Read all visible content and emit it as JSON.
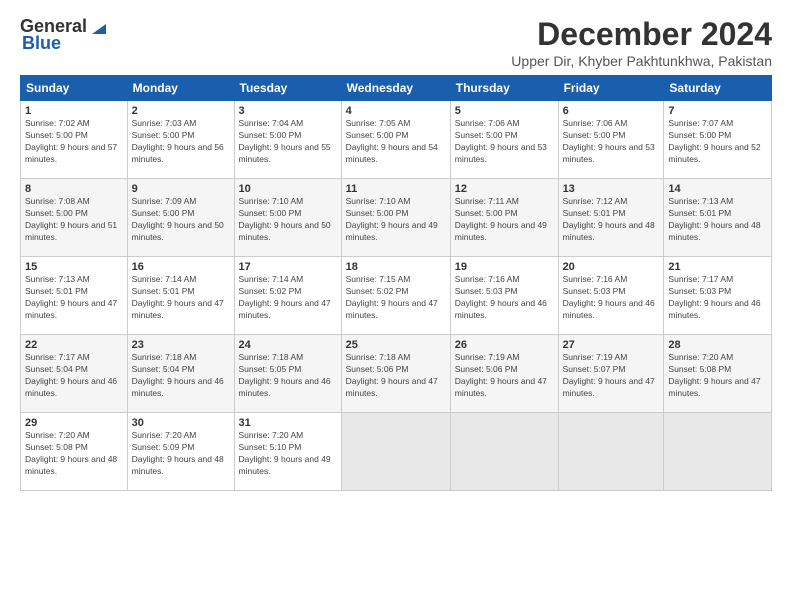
{
  "logo": {
    "general": "General",
    "blue": "Blue"
  },
  "title": "December 2024",
  "location": "Upper Dir, Khyber Pakhtunkhwa, Pakistan",
  "days_of_week": [
    "Sunday",
    "Monday",
    "Tuesday",
    "Wednesday",
    "Thursday",
    "Friday",
    "Saturday"
  ],
  "weeks": [
    [
      {
        "day": "1",
        "sunrise": "7:02 AM",
        "sunset": "5:00 PM",
        "daylight": "9 hours and 57 minutes."
      },
      {
        "day": "2",
        "sunrise": "7:03 AM",
        "sunset": "5:00 PM",
        "daylight": "9 hours and 56 minutes."
      },
      {
        "day": "3",
        "sunrise": "7:04 AM",
        "sunset": "5:00 PM",
        "daylight": "9 hours and 55 minutes."
      },
      {
        "day": "4",
        "sunrise": "7:05 AM",
        "sunset": "5:00 PM",
        "daylight": "9 hours and 54 minutes."
      },
      {
        "day": "5",
        "sunrise": "7:06 AM",
        "sunset": "5:00 PM",
        "daylight": "9 hours and 53 minutes."
      },
      {
        "day": "6",
        "sunrise": "7:06 AM",
        "sunset": "5:00 PM",
        "daylight": "9 hours and 53 minutes."
      },
      {
        "day": "7",
        "sunrise": "7:07 AM",
        "sunset": "5:00 PM",
        "daylight": "9 hours and 52 minutes."
      }
    ],
    [
      {
        "day": "8",
        "sunrise": "7:08 AM",
        "sunset": "5:00 PM",
        "daylight": "9 hours and 51 minutes."
      },
      {
        "day": "9",
        "sunrise": "7:09 AM",
        "sunset": "5:00 PM",
        "daylight": "9 hours and 50 minutes."
      },
      {
        "day": "10",
        "sunrise": "7:10 AM",
        "sunset": "5:00 PM",
        "daylight": "9 hours and 50 minutes."
      },
      {
        "day": "11",
        "sunrise": "7:10 AM",
        "sunset": "5:00 PM",
        "daylight": "9 hours and 49 minutes."
      },
      {
        "day": "12",
        "sunrise": "7:11 AM",
        "sunset": "5:00 PM",
        "daylight": "9 hours and 49 minutes."
      },
      {
        "day": "13",
        "sunrise": "7:12 AM",
        "sunset": "5:01 PM",
        "daylight": "9 hours and 48 minutes."
      },
      {
        "day": "14",
        "sunrise": "7:13 AM",
        "sunset": "5:01 PM",
        "daylight": "9 hours and 48 minutes."
      }
    ],
    [
      {
        "day": "15",
        "sunrise": "7:13 AM",
        "sunset": "5:01 PM",
        "daylight": "9 hours and 47 minutes."
      },
      {
        "day": "16",
        "sunrise": "7:14 AM",
        "sunset": "5:01 PM",
        "daylight": "9 hours and 47 minutes."
      },
      {
        "day": "17",
        "sunrise": "7:14 AM",
        "sunset": "5:02 PM",
        "daylight": "9 hours and 47 minutes."
      },
      {
        "day": "18",
        "sunrise": "7:15 AM",
        "sunset": "5:02 PM",
        "daylight": "9 hours and 47 minutes."
      },
      {
        "day": "19",
        "sunrise": "7:16 AM",
        "sunset": "5:03 PM",
        "daylight": "9 hours and 46 minutes."
      },
      {
        "day": "20",
        "sunrise": "7:16 AM",
        "sunset": "5:03 PM",
        "daylight": "9 hours and 46 minutes."
      },
      {
        "day": "21",
        "sunrise": "7:17 AM",
        "sunset": "5:03 PM",
        "daylight": "9 hours and 46 minutes."
      }
    ],
    [
      {
        "day": "22",
        "sunrise": "7:17 AM",
        "sunset": "5:04 PM",
        "daylight": "9 hours and 46 minutes."
      },
      {
        "day": "23",
        "sunrise": "7:18 AM",
        "sunset": "5:04 PM",
        "daylight": "9 hours and 46 minutes."
      },
      {
        "day": "24",
        "sunrise": "7:18 AM",
        "sunset": "5:05 PM",
        "daylight": "9 hours and 46 minutes."
      },
      {
        "day": "25",
        "sunrise": "7:18 AM",
        "sunset": "5:06 PM",
        "daylight": "9 hours and 47 minutes."
      },
      {
        "day": "26",
        "sunrise": "7:19 AM",
        "sunset": "5:06 PM",
        "daylight": "9 hours and 47 minutes."
      },
      {
        "day": "27",
        "sunrise": "7:19 AM",
        "sunset": "5:07 PM",
        "daylight": "9 hours and 47 minutes."
      },
      {
        "day": "28",
        "sunrise": "7:20 AM",
        "sunset": "5:08 PM",
        "daylight": "9 hours and 47 minutes."
      }
    ],
    [
      {
        "day": "29",
        "sunrise": "7:20 AM",
        "sunset": "5:08 PM",
        "daylight": "9 hours and 48 minutes."
      },
      {
        "day": "30",
        "sunrise": "7:20 AM",
        "sunset": "5:09 PM",
        "daylight": "9 hours and 48 minutes."
      },
      {
        "day": "31",
        "sunrise": "7:20 AM",
        "sunset": "5:10 PM",
        "daylight": "9 hours and 49 minutes."
      },
      null,
      null,
      null,
      null
    ]
  ]
}
